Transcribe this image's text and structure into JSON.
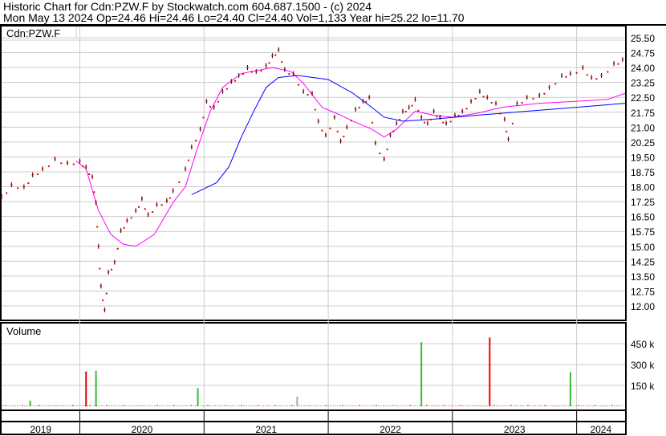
{
  "header": {
    "line1": "Historic Chart for Cdn:PZW.F by Stockwatch.com 604.687.1500 - (c) 2024",
    "line2": "Mon May 13 2024  Op=24.46  Hi=24.46  Lo=24.40  Cl=24.40  Vol=1,133  Year hi=25.22  lo=11.70"
  },
  "chart_data": [
    {
      "type": "line",
      "title": "Cdn:PZW.F",
      "ylim": [
        11.5,
        26.0
      ],
      "xlim": [
        2019.37,
        2024.39
      ],
      "yticks": [
        "25.50",
        "24.75",
        "24.00",
        "23.25",
        "22.50",
        "21.75",
        "21.00",
        "20.25",
        "19.50",
        "18.75",
        "18.00",
        "17.25",
        "16.50",
        "15.75",
        "15.00",
        "14.25",
        "13.50",
        "12.75",
        "12.00"
      ],
      "price": [
        [
          2019.37,
          17.5
        ],
        [
          2019.45,
          18.1
        ],
        [
          2019.55,
          18.0
        ],
        [
          2019.62,
          18.6
        ],
        [
          2019.7,
          18.9
        ],
        [
          2019.8,
          19.4
        ],
        [
          2019.9,
          19.2
        ],
        [
          2020.0,
          19.3
        ],
        [
          2020.05,
          19.0
        ],
        [
          2020.1,
          18.5
        ],
        [
          2020.13,
          17.2
        ],
        [
          2020.15,
          15.0
        ],
        [
          2020.17,
          13.0
        ],
        [
          2020.2,
          11.8
        ],
        [
          2020.23,
          13.7
        ],
        [
          2020.28,
          14.2
        ],
        [
          2020.33,
          15.8
        ],
        [
          2020.38,
          16.3
        ],
        [
          2020.45,
          16.8
        ],
        [
          2020.5,
          17.4
        ],
        [
          2020.55,
          16.6
        ],
        [
          2020.62,
          17.1
        ],
        [
          2020.7,
          17.3
        ],
        [
          2020.75,
          17.8
        ],
        [
          2020.85,
          18.9
        ],
        [
          2020.9,
          20.0
        ],
        [
          2020.97,
          20.9
        ],
        [
          2021.02,
          22.3
        ],
        [
          2021.08,
          22.0
        ],
        [
          2021.15,
          22.8
        ],
        [
          2021.22,
          23.3
        ],
        [
          2021.28,
          23.6
        ],
        [
          2021.35,
          24.0
        ],
        [
          2021.42,
          23.8
        ],
        [
          2021.5,
          24.1
        ],
        [
          2021.55,
          24.6
        ],
        [
          2021.6,
          24.9
        ],
        [
          2021.65,
          23.9
        ],
        [
          2021.72,
          23.7
        ],
        [
          2021.8,
          22.8
        ],
        [
          2021.87,
          22.7
        ],
        [
          2021.92,
          21.3
        ],
        [
          2021.98,
          20.6
        ],
        [
          2022.05,
          21.5
        ],
        [
          2022.1,
          20.3
        ],
        [
          2022.15,
          21.0
        ],
        [
          2022.22,
          21.9
        ],
        [
          2022.28,
          22.3
        ],
        [
          2022.33,
          22.5
        ],
        [
          2022.38,
          20.2
        ],
        [
          2022.45,
          19.4
        ],
        [
          2022.5,
          20.6
        ],
        [
          2022.55,
          21.2
        ],
        [
          2022.6,
          21.8
        ],
        [
          2022.65,
          22.0
        ],
        [
          2022.7,
          22.4
        ],
        [
          2022.75,
          21.5
        ],
        [
          2022.8,
          21.2
        ],
        [
          2022.85,
          21.8
        ],
        [
          2022.9,
          21.5
        ],
        [
          2022.95,
          21.2
        ],
        [
          2023.02,
          21.6
        ],
        [
          2023.08,
          21.8
        ],
        [
          2023.15,
          22.3
        ],
        [
          2023.22,
          22.8
        ],
        [
          2023.28,
          22.5
        ],
        [
          2023.35,
          22.2
        ],
        [
          2023.42,
          21.4
        ],
        [
          2023.45,
          20.4
        ],
        [
          2023.52,
          22.2
        ],
        [
          2023.6,
          22.5
        ],
        [
          2023.7,
          22.6
        ],
        [
          2023.78,
          23.0
        ],
        [
          2023.88,
          23.6
        ],
        [
          2023.95,
          23.7
        ],
        [
          2024.05,
          24.0
        ],
        [
          2024.12,
          23.5
        ],
        [
          2024.2,
          23.6
        ],
        [
          2024.3,
          24.2
        ],
        [
          2024.37,
          24.4
        ]
      ],
      "series": [
        {
          "name": "short moving average",
          "color": "#ff00ff",
          "points": [
            [
              2019.97,
              19.3
            ],
            [
              2020.05,
              18.9
            ],
            [
              2020.15,
              16.8
            ],
            [
              2020.25,
              15.6
            ],
            [
              2020.35,
              15.1
            ],
            [
              2020.45,
              15.0
            ],
            [
              2020.6,
              15.6
            ],
            [
              2020.75,
              17.2
            ],
            [
              2020.85,
              18.0
            ],
            [
              2020.95,
              20.0
            ],
            [
              2021.05,
              21.8
            ],
            [
              2021.15,
              23.0
            ],
            [
              2021.3,
              23.7
            ],
            [
              2021.55,
              24.0
            ],
            [
              2021.7,
              23.8
            ],
            [
              2021.8,
              23.2
            ],
            [
              2021.95,
              22.0
            ],
            [
              2022.1,
              21.6
            ],
            [
              2022.2,
              21.3
            ],
            [
              2022.35,
              20.9
            ],
            [
              2022.45,
              20.5
            ],
            [
              2022.55,
              20.9
            ],
            [
              2022.7,
              21.8
            ],
            [
              2022.85,
              21.6
            ],
            [
              2023.0,
              21.5
            ],
            [
              2023.2,
              21.7
            ],
            [
              2023.4,
              22.0
            ],
            [
              2023.7,
              22.2
            ],
            [
              2024.0,
              22.3
            ],
            [
              2024.25,
              22.4
            ],
            [
              2024.39,
              22.7
            ]
          ]
        },
        {
          "name": "long moving average",
          "color": "#0000ff",
          "points": [
            [
              2020.9,
              17.6
            ],
            [
              2021.0,
              17.9
            ],
            [
              2021.1,
              18.2
            ],
            [
              2021.2,
              19.0
            ],
            [
              2021.3,
              20.5
            ],
            [
              2021.4,
              21.8
            ],
            [
              2021.5,
              23.0
            ],
            [
              2021.6,
              23.5
            ],
            [
              2021.75,
              23.6
            ],
            [
              2022.0,
              23.4
            ],
            [
              2022.2,
              22.7
            ],
            [
              2022.35,
              22.0
            ],
            [
              2022.45,
              21.5
            ],
            [
              2022.6,
              21.3
            ],
            [
              2022.85,
              21.4
            ],
            [
              2023.2,
              21.6
            ],
            [
              2023.6,
              21.8
            ],
            [
              2024.0,
              22.0
            ],
            [
              2024.39,
              22.2
            ]
          ]
        }
      ]
    },
    {
      "type": "bar",
      "title": "Volume",
      "ylim": [
        0,
        600
      ],
      "units": "k",
      "yticks": [
        "450 k",
        "300 k",
        "150 k"
      ],
      "spikes": [
        {
          "x": 2019.6,
          "v": 40,
          "color": "#33bb33"
        },
        {
          "x": 2020.05,
          "v": 250,
          "color": "#ee0000"
        },
        {
          "x": 2020.13,
          "v": 255,
          "color": "#33bb33"
        },
        {
          "x": 2020.95,
          "v": 130,
          "color": "#33bb33"
        },
        {
          "x": 2021.75,
          "v": 70,
          "color": "#aaaaaa"
        },
        {
          "x": 2022.75,
          "v": 460,
          "color": "#33bb33"
        },
        {
          "x": 2023.3,
          "v": 495,
          "color": "#ee0000"
        },
        {
          "x": 2023.95,
          "v": 245,
          "color": "#33bb33"
        }
      ]
    }
  ],
  "years": [
    "2019",
    "2020",
    "2021",
    "2022",
    "2023",
    "2024"
  ]
}
